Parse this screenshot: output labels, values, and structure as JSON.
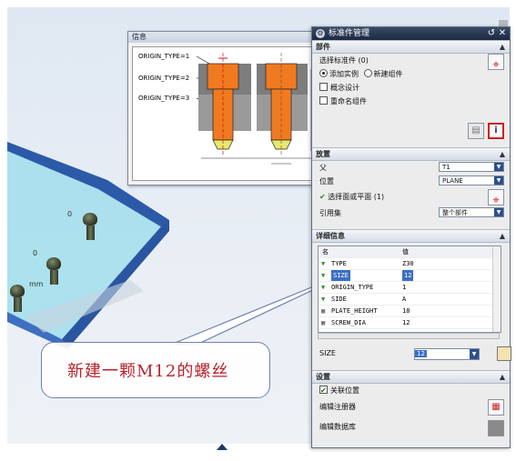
{
  "dialog": {
    "title": "标准件管理",
    "section_part": "部件",
    "select_std_label": "选择标准件 (0)",
    "radio_add_instance": "添加实例",
    "radio_new_component": "新建组件",
    "chk_concept": "概念设计",
    "chk_rename": "重命名组件",
    "section_place": "放置",
    "parent_label": "父",
    "parent_value": "T1",
    "position_label": "位置",
    "position_value": "PLANE",
    "select_face_label": "选择面或平面 (1)",
    "refset_label": "引用集",
    "refset_value": "整个部件",
    "section_detail": "详细信息",
    "table_headers": [
      "名",
      "值"
    ],
    "table_rows": [
      {
        "name": "TYPE",
        "value": "Z30"
      },
      {
        "name": "SIZE",
        "value": "12"
      },
      {
        "name": "ORIGIN_TYPE",
        "value": "1"
      },
      {
        "name": "SIDE",
        "value": "A"
      },
      {
        "name": "PLATE_HEIGHT",
        "value": "18"
      },
      {
        "name": "SCREW_DIA",
        "value": "12"
      }
    ],
    "size_label": "SIZE",
    "size_value": "12",
    "section_settings": "设置",
    "chk_assoc_pos": "关联位置",
    "edit_register": "编辑注册器",
    "edit_database": "编辑数据库"
  },
  "info_window": {
    "title": "信息",
    "origin_labels": [
      "ORIGIN_TYPE=1",
      "ORIGIN_TYPE=2",
      "ORIGIN_TYPE=3"
    ]
  },
  "viewport": {
    "dim_labels": [
      "0",
      "0",
      "mm"
    ]
  },
  "callout": {
    "text": "新建一颗M12的螺丝"
  },
  "colors": {
    "accent": "#3a6fc4",
    "callout_text": "#b8232b",
    "plate_top": "#a8e0ee",
    "plate_side": "#2c5aa8"
  }
}
